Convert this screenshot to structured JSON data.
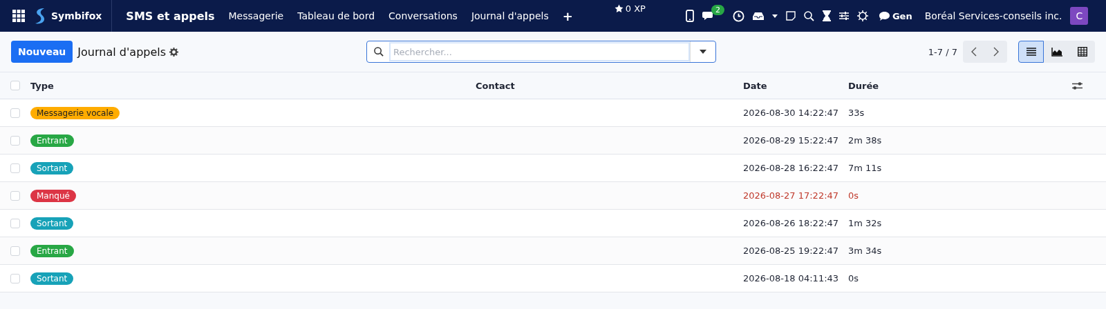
{
  "navbar": {
    "brand": "Symbifox",
    "app": "SMS et appels",
    "menu": [
      "Messagerie",
      "Tableau de bord",
      "Conversations",
      "Journal d'appels"
    ],
    "add": "+",
    "xp": "0 XP",
    "chat_badge": "2",
    "channel": "Gen",
    "company": "Boréal Services-conseils inc.",
    "avatar": "C"
  },
  "control": {
    "new_button": "Nouveau",
    "title": "Journal d'appels",
    "search": {
      "placeholder": "Rechercher..."
    },
    "pager": "1-7 / 7",
    "views": [
      {
        "kind": "list",
        "selected": true
      },
      {
        "kind": "graph",
        "selected": false
      },
      {
        "kind": "pivot",
        "selected": false
      }
    ]
  },
  "table": {
    "all_checked": false,
    "columns": [
      "Type",
      "Contact",
      "Date",
      "Durée"
    ],
    "rows": [
      {
        "type": "Messagerie vocale",
        "color": "#ffac00",
        "date": "2026-08-30 14:22:47",
        "duration": "33s",
        "missed": false,
        "checked": false
      },
      {
        "type": "Entrant",
        "color": "#28a745",
        "date": "2026-08-29 15:22:47",
        "duration": "2m 38s",
        "missed": false,
        "checked": false
      },
      {
        "type": "Sortant",
        "color": "#17a2b8",
        "date": "2026-08-28 16:22:47",
        "duration": "7m 11s",
        "missed": false,
        "checked": false
      },
      {
        "type": "Manqué",
        "color": "#dc3545",
        "date": "2026-08-27 17:22:47",
        "duration": "0s",
        "missed": true,
        "checked": false
      },
      {
        "type": "Sortant",
        "color": "#17a2b8",
        "date": "2026-08-26 18:22:47",
        "duration": "1m 32s",
        "missed": false,
        "checked": false
      },
      {
        "type": "Entrant",
        "color": "#28a745",
        "date": "2026-08-25 19:22:47",
        "duration": "3m 34s",
        "missed": false,
        "checked": false
      },
      {
        "type": "Sortant",
        "color": "#17a2b8",
        "date": "2026-08-18 04:11:43",
        "duration": "0s",
        "missed": false,
        "checked": false
      }
    ]
  }
}
